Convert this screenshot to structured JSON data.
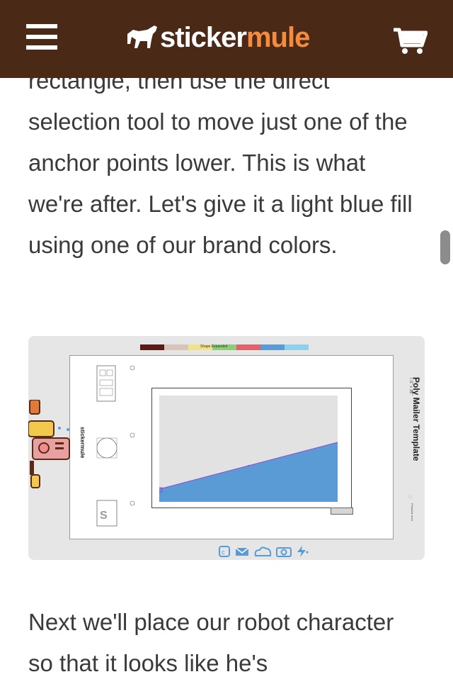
{
  "header": {
    "brand_word1": "sticker",
    "brand_word2": "mule",
    "menu_icon": "hamburger-icon",
    "cart_icon": "cart-icon"
  },
  "colors": {
    "header_bg": "#4a2a17",
    "brand_accent": "#f58b3f",
    "fill_blue": "#5b9bd5"
  },
  "article": {
    "paragraph_1": "rectangle, then use the direct selection tool to move just one of the anchor points lower. This is what we're after. Let's give it a light blue fill using one of our brand colors.",
    "paragraph_2": "Next we'll place our robot character so that it looks like he's"
  },
  "figure": {
    "template_title": "Poly Mailer Template",
    "template_size": "7.5\" x 12\"",
    "palette_label": "Shape Expanded",
    "printable_label": "Printable area",
    "logo_text": "stickermule",
    "palette_colors": [
      "#5c1a16",
      "#d8c4b8",
      "#f2e08a",
      "#8fcc7a",
      "#e0626a",
      "#5b9bd5",
      "#8fd0ea"
    ],
    "tool_icons": [
      "sticker-tool-icon",
      "mail-tool-icon",
      "cloud-tool-icon",
      "camera-tool-icon",
      "bolt-tool-icon"
    ]
  }
}
